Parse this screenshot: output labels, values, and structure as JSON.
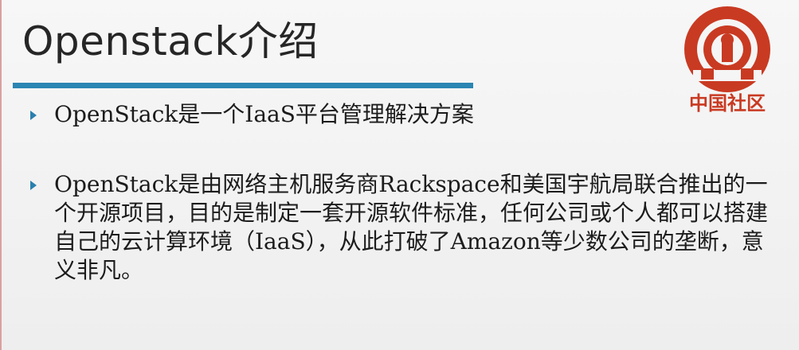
{
  "slide": {
    "title": "Openstack介绍",
    "bullets": [
      {
        "text": "OpenStack是一个IaaS平台管理解决方案"
      },
      {
        "text": "OpenStack是由网络主机服务商Rackspace和美国宇航局联合推出的一个开源项目，目的是制定一套开源软件标准，任何公司或个人都可以搭建自己的云计算环境（IaaS），从此打破了Amazon等少数公司的垄断，意义非凡。"
      }
    ]
  },
  "logo": {
    "icon": "community-logo-icon",
    "text": "中国社区"
  },
  "colors": {
    "accent_rule": "#2a86b3",
    "bullet_marker": "#2a7fae",
    "logo_red": "#c93a22"
  }
}
